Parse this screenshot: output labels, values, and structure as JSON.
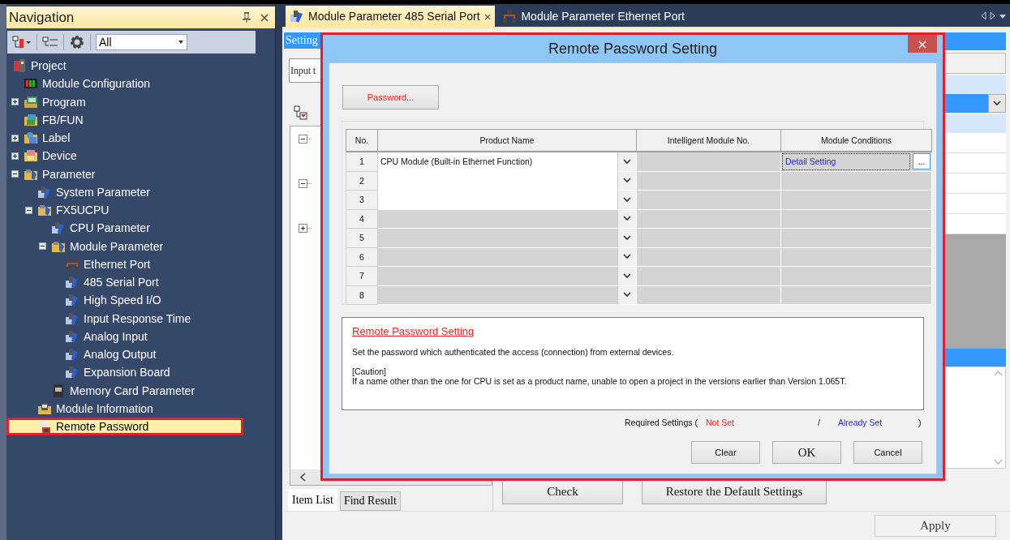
{
  "navigation": {
    "title": "Navigation",
    "filter": {
      "value": "All"
    },
    "tree": [
      {
        "label": "Project",
        "kind": "project",
        "selected": false,
        "children": [
          {
            "label": "Module Configuration",
            "kind": "config",
            "selected": false
          },
          {
            "label": "Program",
            "kind": "program",
            "expanded": false,
            "selected": false
          },
          {
            "label": "FB/FUN",
            "kind": "fb",
            "selected": false
          },
          {
            "label": "Label",
            "kind": "label",
            "expanded": false,
            "selected": false
          },
          {
            "label": "Device",
            "kind": "device",
            "expanded": false,
            "selected": false
          },
          {
            "label": "Parameter",
            "kind": "folder",
            "expanded": true,
            "selected": false,
            "children": [
              {
                "label": "System Parameter",
                "kind": "param",
                "selected": false
              },
              {
                "label": "FX5UCPU",
                "kind": "folder",
                "expanded": true,
                "selected": false,
                "children": [
                  {
                    "label": "CPU Parameter",
                    "kind": "param",
                    "selected": false
                  },
                  {
                    "label": "Module Parameter",
                    "kind": "folder",
                    "expanded": true,
                    "selected": false,
                    "children": [
                      {
                        "label": "Ethernet Port",
                        "kind": "network",
                        "selected": false
                      },
                      {
                        "label": "485 Serial Port",
                        "kind": "param",
                        "selected": false
                      },
                      {
                        "label": "High Speed I/O",
                        "kind": "param",
                        "selected": false
                      },
                      {
                        "label": "Input Response Time",
                        "kind": "param",
                        "selected": false
                      },
                      {
                        "label": "Analog Input",
                        "kind": "param",
                        "selected": false
                      },
                      {
                        "label": "Analog Output",
                        "kind": "param",
                        "selected": false
                      },
                      {
                        "label": "Expansion Board",
                        "kind": "param",
                        "selected": false
                      }
                    ]
                  },
                  {
                    "label": "Memory Card Parameter",
                    "kind": "card",
                    "selected": false
                  }
                ]
              },
              {
                "label": "Module Information",
                "kind": "info",
                "selected": false
              },
              {
                "label": "Remote Password",
                "kind": "password",
                "selected": true
              }
            ]
          }
        ]
      }
    ]
  },
  "editor": {
    "tabs": [
      {
        "label": "Module Parameter 485 Serial Port",
        "selected": true,
        "close": "×"
      },
      {
        "label": "Module Parameter Ethernet Port",
        "selected": false
      }
    ],
    "setting_header": "Setting",
    "search_field": {
      "placeholder": "Input t"
    },
    "tree_nodes": [
      {
        "expanded": true
      },
      {
        "expanded": true
      },
      {
        "expanded": false
      }
    ],
    "bottom_tabs": [
      {
        "label": "Item List",
        "selected": true
      },
      {
        "label": "Find Result",
        "selected": false
      }
    ],
    "buttons": [
      "Check",
      "Restore the Default Settings"
    ],
    "apply": "Apply"
  },
  "dialog": {
    "title": "Remote Password Setting",
    "highlighted": true,
    "close": "×",
    "password_button": "Password...",
    "table": {
      "columns": [
        "No.",
        "Product Name",
        "Intelligent Module No.",
        "Module Conditions"
      ],
      "rows": [
        {
          "no": "1",
          "product_name": "CPU Module (Built-in Ethernet Function)",
          "editable": true,
          "module_conditions": "Detail Setting",
          "detail_button": "..."
        },
        {
          "no": "2",
          "editable": true
        },
        {
          "no": "3",
          "editable": true
        },
        {
          "no": "4",
          "editable": false
        },
        {
          "no": "5",
          "editable": false
        },
        {
          "no": "6",
          "editable": false
        },
        {
          "no": "7",
          "editable": false
        },
        {
          "no": "8",
          "editable": false
        }
      ]
    },
    "description": {
      "title": "Remote Password Setting",
      "text": "Set the password which authenticated the access (connection) from external devices.",
      "caution_label": "[Caution]",
      "caution_text": "If a name other than the one for CPU is set as a product name, unable to open a project in the versions earlier than Version 1.065T."
    },
    "required_settings": {
      "label": "Required Settings (",
      "not_set": "Not Set",
      "separator": "/",
      "already_set": "Already Set",
      "end": ")"
    },
    "buttons": [
      "Clear",
      "OK",
      "Cancel"
    ]
  }
}
